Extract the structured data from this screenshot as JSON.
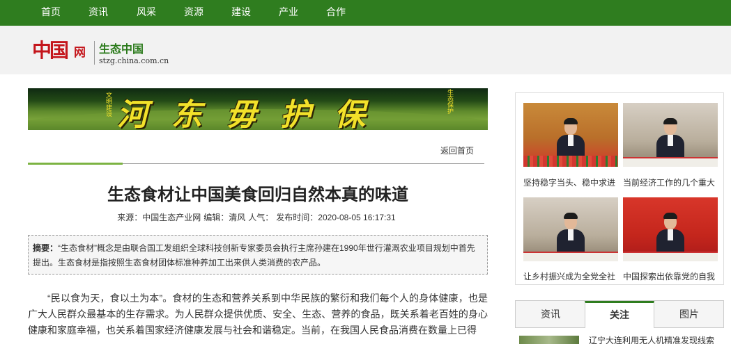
{
  "nav": [
    "首页",
    "资讯",
    "风采",
    "资源",
    "建设",
    "产业",
    "合作"
  ],
  "logo": {
    "china_mark": "中国",
    "wang": "网",
    "site_title": "生态中国",
    "domain": "stzg.china.com.cn"
  },
  "banner": {
    "text": "河东毋护保",
    "side_left": "文明建设",
    "side_right": "生态保护"
  },
  "back_home": "返回首页",
  "article": {
    "title": "生态食材让中国美食回归自然本真的味道",
    "meta_source": "来源：中国生态产业网",
    "meta_editor": "编辑：清风",
    "meta_popularity": "人气：",
    "meta_time": "发布时间：2020-08-05 16:17:31",
    "abstract_label": "摘要：",
    "abstract_text": "“生态食材”概念是由联合国工发组织全球科技创新专家委员会执行主席孙建在1990年世行灌溉农业项目规划中首先提出。生态食材是指按照生态食材团体标准种养加工出来供人类消费的农产品。",
    "body": "“民以食为天，食以土为本”。食材的生态和营养关系到中华民族的繁衍和我们每个人的身体健康，也是广大人民群众最基本的生存需求。为人民群众提供优质、安全、生态、营养的食品，既关系着老百姓的身心健康和家庭幸福，也关系着国家经济健康发展与社会和谐稳定。当前，在我国人民食品消费在数量上已得"
  },
  "sidebar": {
    "captions": [
      "坚持稳字当头、稳中求进",
      "当前经济工作的几个重大",
      "让乡村振兴成为全党全社",
      "中国探索出依靠党的自我"
    ]
  },
  "tabs": [
    "资讯",
    "关注",
    "图片"
  ],
  "active_tab": "关注",
  "news_first": "辽宁大连利用无人机精准发现线索"
}
